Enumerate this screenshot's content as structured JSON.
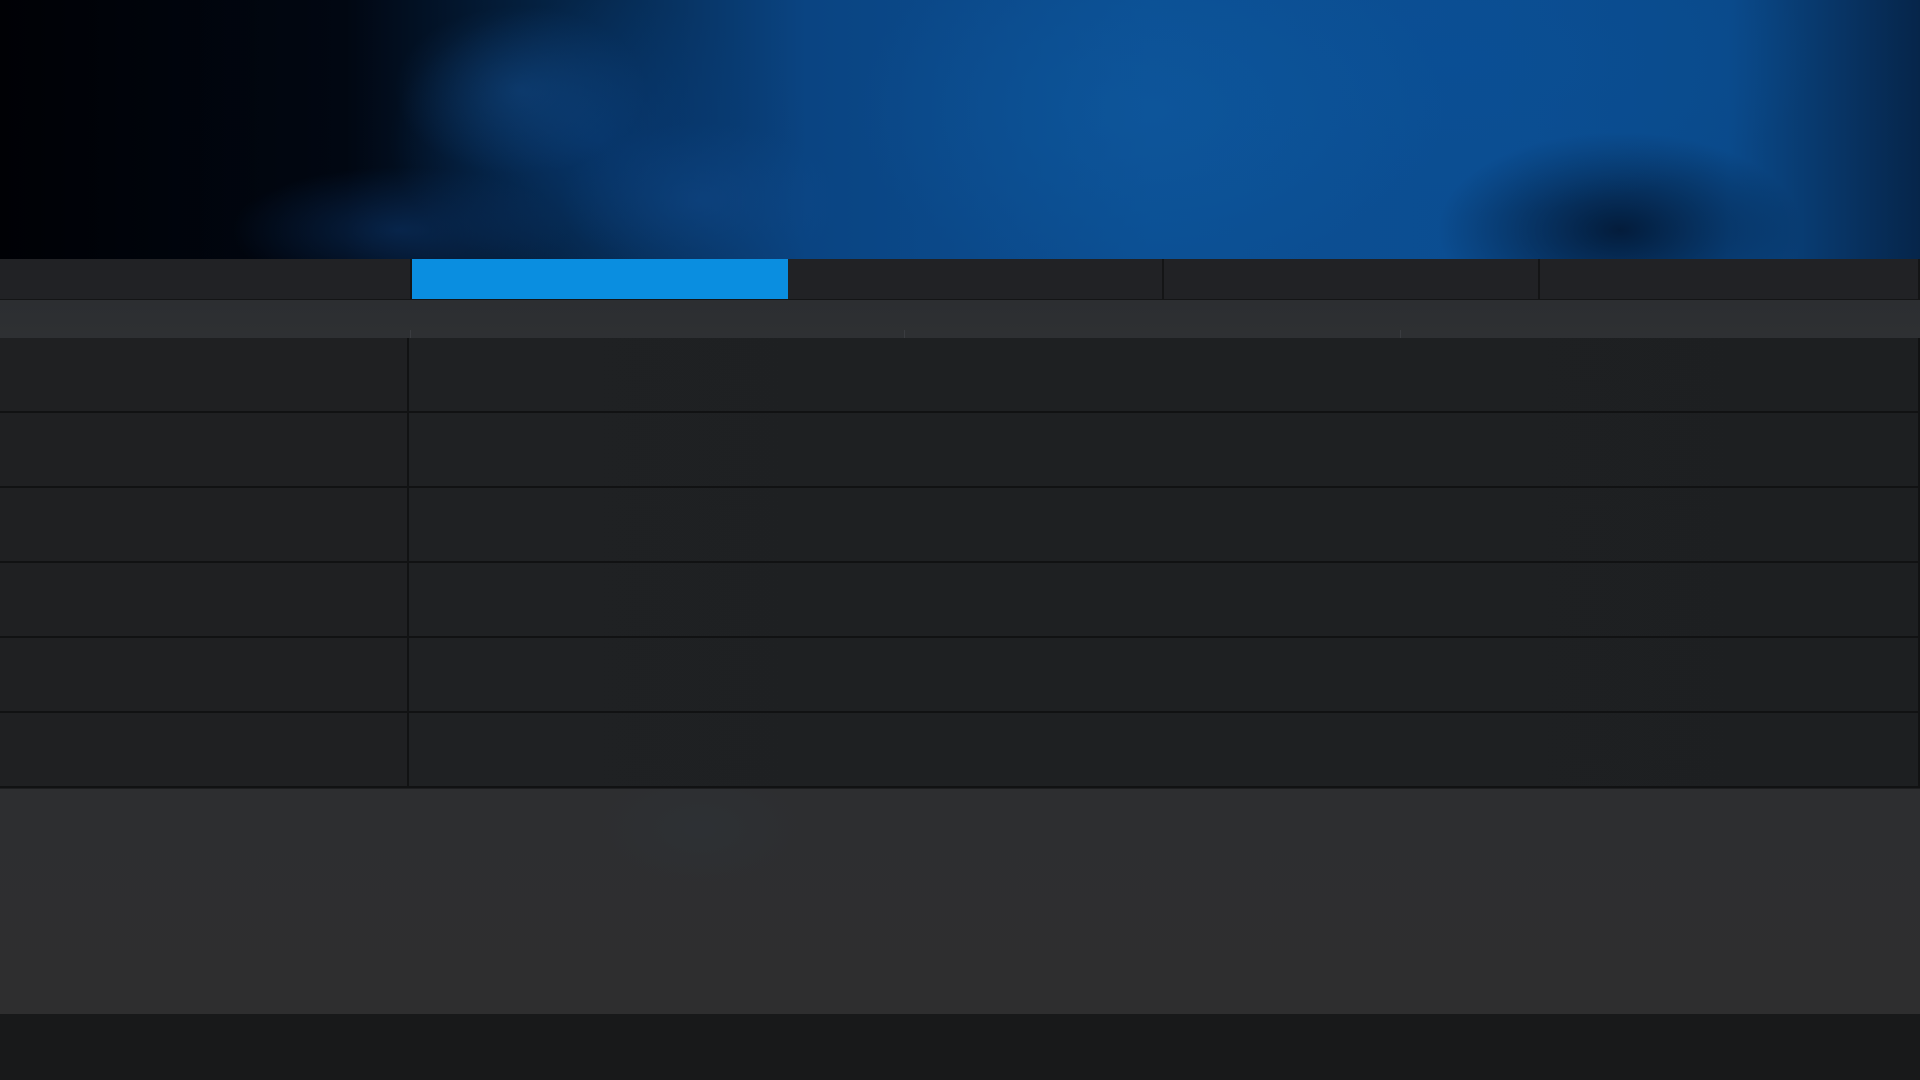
{
  "banner": {},
  "tabs": [
    {
      "label": "",
      "active": false
    },
    {
      "label": "",
      "active": true
    },
    {
      "label": "",
      "active": false
    },
    {
      "label": "",
      "active": false
    },
    {
      "label": "",
      "active": false
    }
  ],
  "columns": [
    "",
    "",
    "",
    ""
  ],
  "rows": [
    {
      "name": "",
      "value": ""
    },
    {
      "name": "",
      "value": ""
    },
    {
      "name": "",
      "value": ""
    },
    {
      "name": "",
      "value": ""
    },
    {
      "name": "",
      "value": ""
    },
    {
      "name": "",
      "value": ""
    }
  ],
  "footer": {
    "text": ""
  },
  "colors": {
    "accent": "#0a8ee0",
    "background": "#1d1e20",
    "panel": "#2d2e30",
    "footer": "#18191a",
    "banner_blue": "#0c4f93"
  }
}
